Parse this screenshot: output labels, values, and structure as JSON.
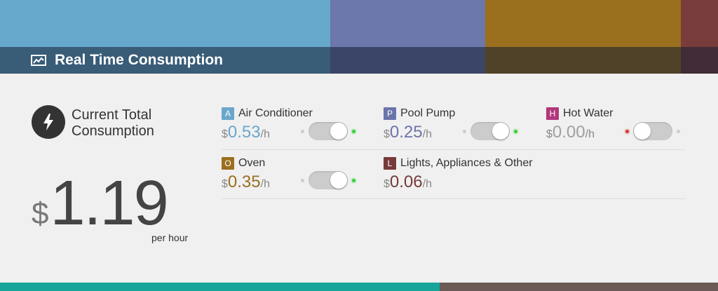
{
  "header": {
    "title": "Real Time Consumption",
    "icon": "line-chart-icon",
    "band_colors": [
      "#67a8cd",
      "#6c77ab",
      "#9a6f1d",
      "#783c3c"
    ]
  },
  "total": {
    "icon": "lightning-icon",
    "label_line1": "Current Total",
    "label_line2": "Consumption",
    "currency": "$",
    "amount": "1.19",
    "unit": "per hour"
  },
  "devices": [
    {
      "letter": "A",
      "name": "Air Conditioner",
      "currency": "$",
      "value": "0.53",
      "unit": "/h",
      "color": "#6aa6cc",
      "toggle": "on"
    },
    {
      "letter": "P",
      "name": "Pool Pump",
      "currency": "$",
      "value": "0.25",
      "unit": "/h",
      "color": "#6b74aa",
      "toggle": "on"
    },
    {
      "letter": "H",
      "name": "Hot Water",
      "currency": "$",
      "value": "0.00",
      "unit": "/h",
      "color": "#b2367b",
      "toggle": "off"
    },
    {
      "letter": "O",
      "name": "Oven",
      "currency": "$",
      "value": "0.35",
      "unit": "/h",
      "color": "#9b6f1f",
      "toggle": "on"
    },
    {
      "letter": "L",
      "name": "Lights, Appliances & Other",
      "currency": "$",
      "value": "0.06",
      "unit": "/h",
      "color": "#773a3a",
      "toggle": null
    }
  ],
  "footer": {
    "strip_colors": [
      "#17a59a",
      "#6b5a55"
    ]
  }
}
